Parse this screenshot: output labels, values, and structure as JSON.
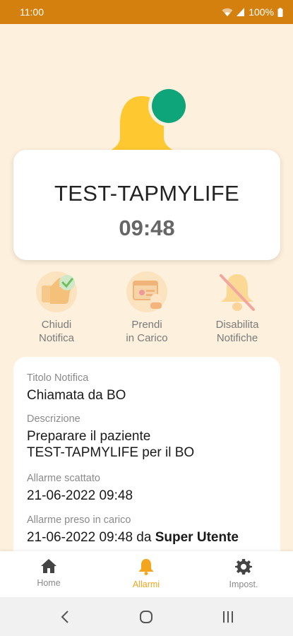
{
  "status_bar": {
    "time": "11:00",
    "battery": "100%"
  },
  "alarm": {
    "patient": "TEST-TAPMYLIFE",
    "time": "09:48"
  },
  "actions": [
    {
      "line1": "Chiudi",
      "line2": "Notifica"
    },
    {
      "line1": "Prendi",
      "line2": "in Carico"
    },
    {
      "line1": "Disabilita",
      "line2": "Notifiche"
    }
  ],
  "details": {
    "title_label": "Titolo Notifica",
    "title_value": "Chiamata da BO",
    "description_label": "Descrizione",
    "description_line1": "Preparare il paziente",
    "description_line2": "TEST-TAPMYLIFE per il BO",
    "triggered_label": "Allarme scattato",
    "triggered_value": "21-06-2022 09:48",
    "taken_label": "Allarme preso in carico",
    "taken_value": "21-06-2022 09:48 da",
    "taken_user": "Super Utente"
  },
  "bottom_nav": {
    "items": [
      {
        "label": "Home",
        "icon": "home-icon"
      },
      {
        "label": "Allarmi",
        "icon": "bell-icon",
        "active": true
      },
      {
        "label": "Impost.",
        "icon": "gear-icon"
      }
    ]
  },
  "colors": {
    "status_bar": "#d4800e",
    "background": "#fdf0dc",
    "accent": "#f2a51d",
    "bell": "#fdc830",
    "dot": "#0ea57a"
  }
}
